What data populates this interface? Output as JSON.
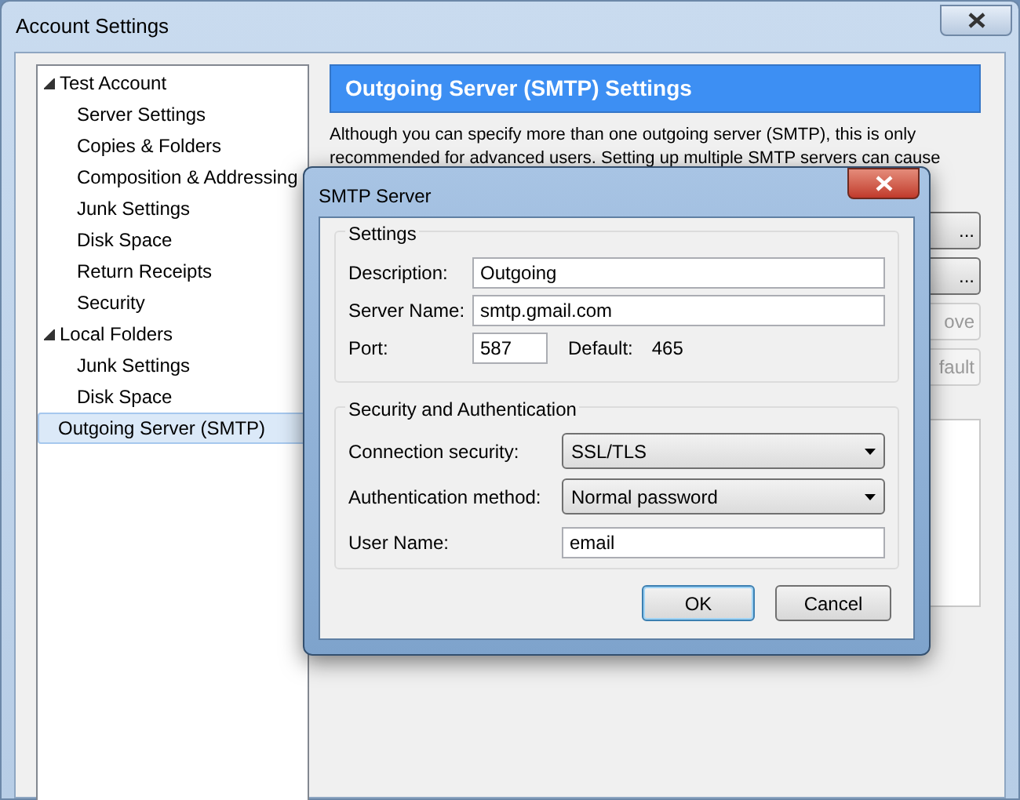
{
  "window": {
    "title": "Account Settings"
  },
  "sidebar": {
    "items": [
      {
        "label": "Test Account",
        "selected": false,
        "expanded": true,
        "children": [
          {
            "label": "Server Settings",
            "selected": false
          },
          {
            "label": "Copies & Folders",
            "selected": false
          },
          {
            "label": "Composition & Addressing",
            "selected": false
          },
          {
            "label": "Junk Settings",
            "selected": false
          },
          {
            "label": "Disk Space",
            "selected": false
          },
          {
            "label": "Return Receipts",
            "selected": false
          },
          {
            "label": "Security",
            "selected": false
          }
        ]
      },
      {
        "label": "Local Folders",
        "selected": false,
        "expanded": true,
        "children": [
          {
            "label": "Junk Settings",
            "selected": false
          },
          {
            "label": "Disk Space",
            "selected": false
          }
        ]
      },
      {
        "label": "Outgoing Server (SMTP)",
        "selected": true
      }
    ]
  },
  "main": {
    "heading": "Outgoing Server (SMTP) Settings",
    "description": "Although you can specify more than one outgoing server (SMTP), this is only recommended for advanced users. Setting up multiple SMTP servers can cause",
    "buttons": [
      {
        "label": "...",
        "disabled": false
      },
      {
        "label": "...",
        "disabled": false
      },
      {
        "label": "ove",
        "disabled": true
      },
      {
        "label": "fault",
        "disabled": true
      }
    ]
  },
  "dialog": {
    "title": "SMTP Server",
    "settings": {
      "legend": "Settings",
      "description_label": "Description:",
      "description": "Outgoing",
      "server_label": "Server Name:",
      "server": "smtp.gmail.com",
      "port_label": "Port:",
      "port": "587",
      "default_label": "Default:",
      "default_port": "465"
    },
    "security": {
      "legend": "Security and Authentication",
      "connection_label": "Connection security:",
      "connection": "SSL/TLS",
      "auth_label": "Authentication method:",
      "auth": "Normal password",
      "user_label": "User Name:",
      "user": "email"
    },
    "buttons": [
      "OK",
      "Cancel"
    ]
  }
}
